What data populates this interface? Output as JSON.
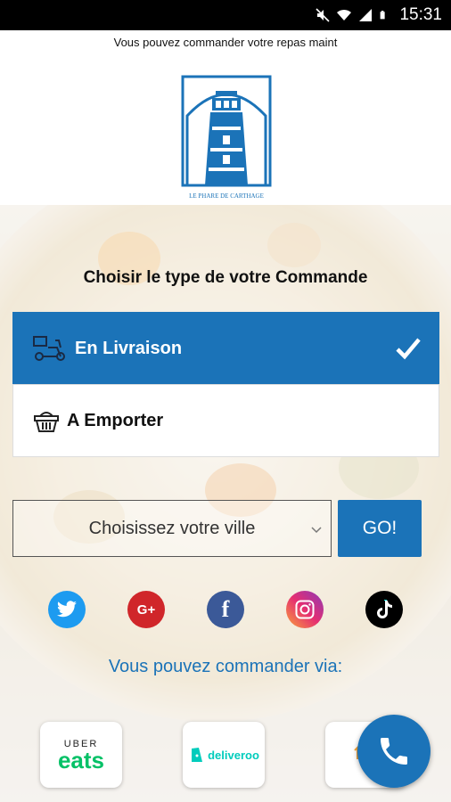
{
  "status_bar": {
    "time": "15:31",
    "icons": [
      "mute-icon",
      "wifi-icon",
      "signal-icon",
      "battery-icon"
    ]
  },
  "header": {
    "marquee_text": "Vous pouvez commander votre repas maint",
    "logo_caption": "LE PHARE DE CARTHAGE"
  },
  "order_type": {
    "title": "Choisir le type de votre Commande",
    "options": [
      {
        "label": "En Livraison",
        "icon": "delivery-scooter-icon",
        "selected": true
      },
      {
        "label": "A Emporter",
        "icon": "basket-icon",
        "selected": false
      }
    ]
  },
  "city": {
    "placeholder": "Choisissez votre ville",
    "go_label": "GO!"
  },
  "social": [
    "twitter",
    "google-plus",
    "facebook",
    "instagram",
    "tiktok"
  ],
  "partners_title": "Vous pouvez commander via:",
  "partners": [
    {
      "name": "uber-eats",
      "line1": "UBER",
      "line2": "eats"
    },
    {
      "name": "deliveroo",
      "line1": "deliveroo"
    }
  ],
  "colors": {
    "primary": "#1b73b8",
    "uber_green": "#06c167",
    "deliveroo": "#00ccbc"
  }
}
